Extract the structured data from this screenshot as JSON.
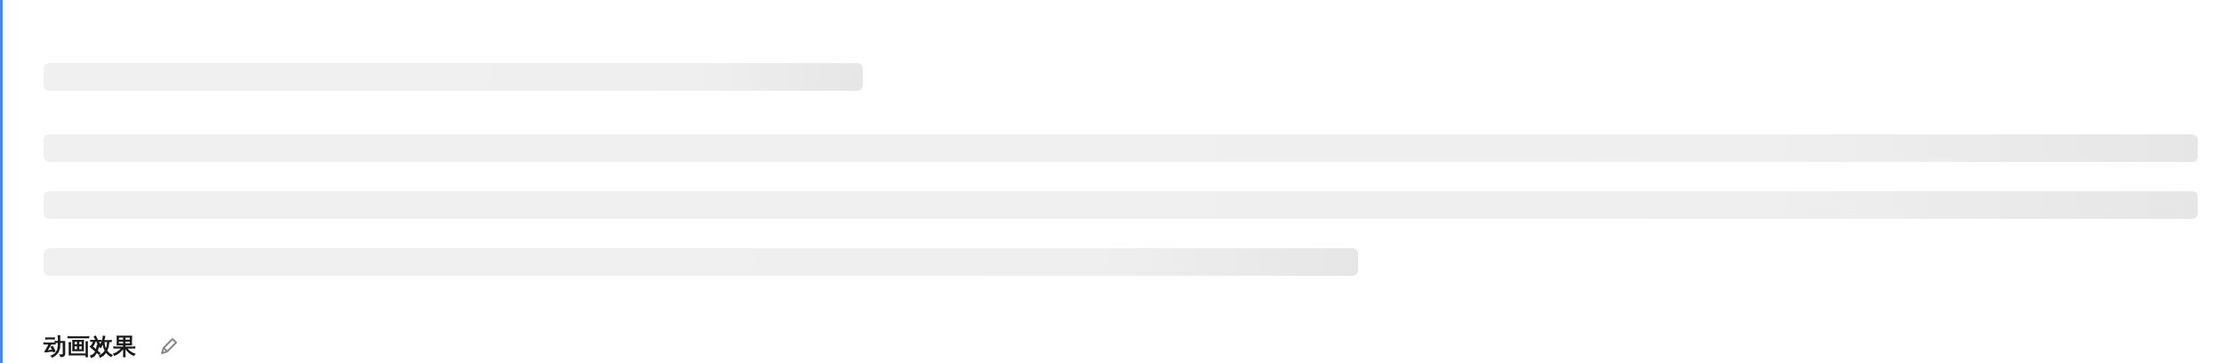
{
  "skeleton": [
    {
      "kind": "title"
    },
    {
      "kind": "line"
    },
    {
      "kind": "line"
    },
    {
      "kind": "line-end"
    }
  ],
  "section": {
    "heading": "动画效果"
  }
}
